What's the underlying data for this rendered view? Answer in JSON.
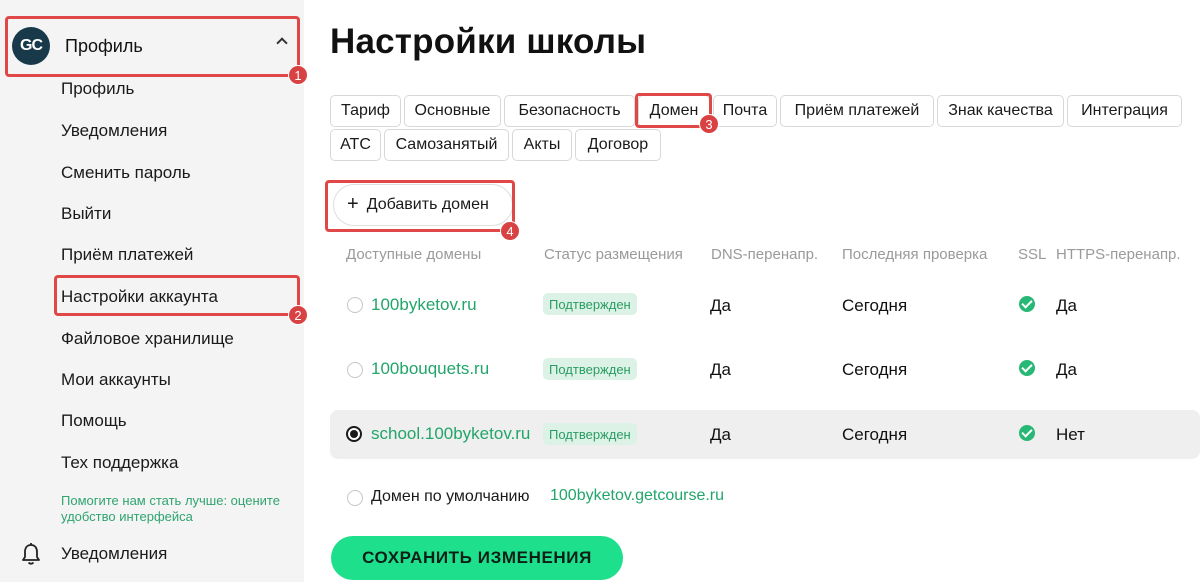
{
  "sidebar": {
    "avatar_text": "GC",
    "profile_label": "Профиль",
    "items": [
      {
        "label": "Профиль"
      },
      {
        "label": "Уведомления"
      },
      {
        "label": "Сменить пароль"
      },
      {
        "label": "Выйти"
      },
      {
        "label": "Приём платежей"
      },
      {
        "label": "Настройки аккаунта"
      },
      {
        "label": "Файловое хранилище"
      },
      {
        "label": "Мои аккаунты"
      },
      {
        "label": "Помощь"
      },
      {
        "label": "Тех поддержка"
      }
    ],
    "feedback_hint": "Помогите нам стать лучше: оцените удобство интерфейса",
    "notifications_label": "Уведомления"
  },
  "main": {
    "title": "Настройки школы",
    "tabs": [
      {
        "label": "Тариф"
      },
      {
        "label": "Основные"
      },
      {
        "label": "Безопасность"
      },
      {
        "label": "Домен"
      },
      {
        "label": "Почта"
      },
      {
        "label": "Приём платежей"
      },
      {
        "label": "Знак качества"
      },
      {
        "label": "Интеграция"
      },
      {
        "label": "АТС"
      },
      {
        "label": "Самозанятый"
      },
      {
        "label": "Акты"
      },
      {
        "label": "Договор"
      }
    ],
    "add_domain_label": "Добавить домен",
    "table": {
      "headers": [
        "Доступные домены",
        "Статус размещения",
        "DNS-перенапр.",
        "Последняя проверка",
        "SSL",
        "HTTPS-перенапр."
      ],
      "rows": [
        {
          "domain": "100byketov.ru",
          "status": "Подтвержден",
          "dns": "Да",
          "last_check": "Сегодня",
          "ssl": true,
          "https": "Да",
          "selected": false
        },
        {
          "domain": "100bouquets.ru",
          "status": "Подтвержден",
          "dns": "Да",
          "last_check": "Сегодня",
          "ssl": true,
          "https": "Да",
          "selected": false
        },
        {
          "domain": "school.100byketov.ru",
          "status": "Подтвержден",
          "dns": "Да",
          "last_check": "Сегодня",
          "ssl": true,
          "https": "Нет",
          "selected": true
        }
      ]
    },
    "default_domain_label": "Домен по умолчанию",
    "default_domain_value": "100byketov.getcourse.ru",
    "save_label": "СОХРАНИТЬ ИЗМЕНЕНИЯ"
  },
  "annotations": [
    "1",
    "2",
    "3",
    "4"
  ],
  "colors": {
    "accent_green": "#1ee08c",
    "link_green": "#22a56a",
    "annotation_red": "#e04848"
  }
}
